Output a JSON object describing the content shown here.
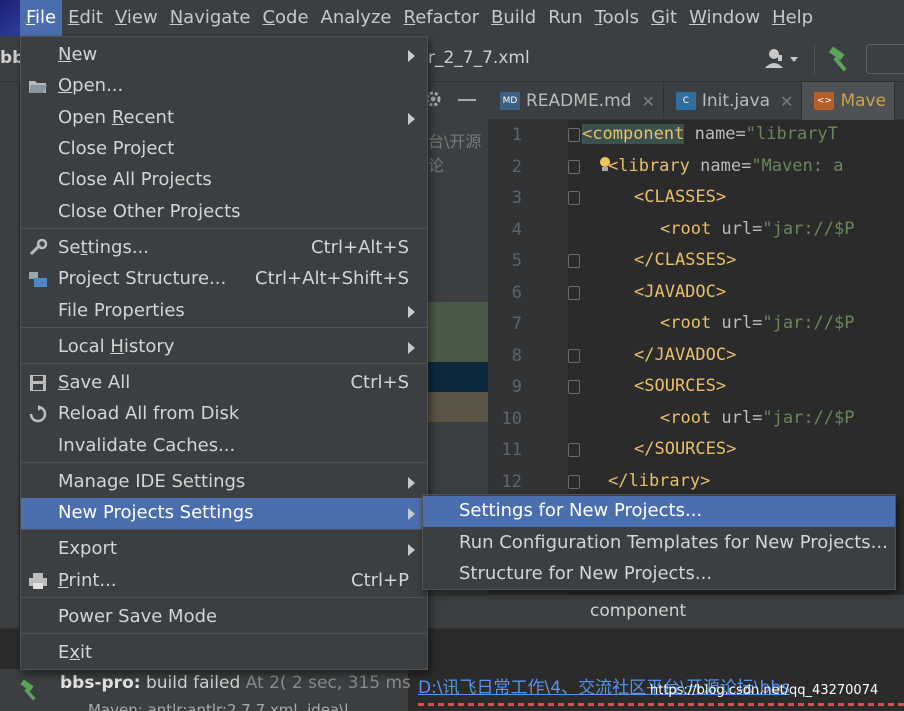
{
  "menubar": {
    "items": [
      {
        "label": "File",
        "mnemonic": "F",
        "rest": "ile"
      },
      {
        "label": "Edit",
        "mnemonic": "E",
        "rest": "dit"
      },
      {
        "label": "View",
        "mnemonic": "V",
        "rest": "iew"
      },
      {
        "label": "Navigate",
        "mnemonic": "N",
        "rest": "avigate"
      },
      {
        "label": "Code",
        "mnemonic": "C",
        "rest": "ode"
      },
      {
        "label": "Analyze",
        "mnemonic": "",
        "rest": "Analyze"
      },
      {
        "label": "Refactor",
        "mnemonic": "R",
        "rest": "efactor"
      },
      {
        "label": "Build",
        "mnemonic": "B",
        "rest": "uild"
      },
      {
        "label": "Run",
        "mnemonic": "",
        "rest": "Run"
      },
      {
        "label": "Tools",
        "mnemonic": "T",
        "rest": "ools"
      },
      {
        "label": "Git",
        "mnemonic": "G",
        "rest": "it"
      },
      {
        "label": "Window",
        "mnemonic": "W",
        "rest": "indow"
      },
      {
        "label": "Help",
        "mnemonic": "H",
        "rest": "elp"
      }
    ]
  },
  "toolbar": {
    "project_fragment": "bb",
    "file_fragment": "r_2_7_7.xml"
  },
  "project_panel": {
    "path_hint": "台\\开源论"
  },
  "tabs": [
    {
      "label": "README.md",
      "icon": "MD",
      "icon_color": "#3d6185"
    },
    {
      "label": "Init.java",
      "icon": "C",
      "icon_color": "#2f6e9e"
    },
    {
      "label": "Mave",
      "icon": "<>",
      "icon_color": "#b5602a"
    }
  ],
  "editor": {
    "lines": [
      {
        "n": "1",
        "tag": "<component",
        "attr": " name=",
        "str": "\"libraryT"
      },
      {
        "n": "2",
        "tag": "<library",
        "attr": " name=",
        "str": "\"Maven: a"
      },
      {
        "n": "3",
        "tag": "<CLASSES>",
        "attr": "",
        "str": ""
      },
      {
        "n": "4",
        "tag": "<root",
        "attr": " url=",
        "str": "\"jar://$P"
      },
      {
        "n": "5",
        "tag": "</CLASSES>",
        "attr": "",
        "str": ""
      },
      {
        "n": "6",
        "tag": "<JAVADOC>",
        "attr": "",
        "str": ""
      },
      {
        "n": "7",
        "tag": "<root",
        "attr": " url=",
        "str": "\"jar://$P"
      },
      {
        "n": "8",
        "tag": "</JAVADOC>",
        "attr": "",
        "str": ""
      },
      {
        "n": "9",
        "tag": "<SOURCES>",
        "attr": "",
        "str": ""
      },
      {
        "n": "10",
        "tag": "<root",
        "attr": " url=",
        "str": "\"jar://$P"
      },
      {
        "n": "11",
        "tag": "</SOURCES>",
        "attr": "",
        "str": ""
      },
      {
        "n": "12",
        "tag": "</library>",
        "attr": "",
        "str": ""
      }
    ],
    "breadcrumb": "component"
  },
  "file_menu": {
    "items": [
      {
        "label": "New",
        "shortcut": "",
        "submenu": true
      },
      {
        "label": "Open...",
        "shortcut": "",
        "submenu": false
      },
      {
        "label": "Open Recent",
        "shortcut": "",
        "submenu": true
      },
      {
        "label": "Close Project",
        "shortcut": "",
        "submenu": false
      },
      {
        "label": "Close All Projects",
        "shortcut": "",
        "submenu": false
      },
      {
        "label": "Close Other Projects",
        "shortcut": "",
        "submenu": false
      },
      {
        "label": "Settings...",
        "shortcut": "Ctrl+Alt+S",
        "submenu": false
      },
      {
        "label": "Project Structure...",
        "shortcut": "Ctrl+Alt+Shift+S",
        "submenu": false
      },
      {
        "label": "File Properties",
        "shortcut": "",
        "submenu": true
      },
      {
        "label": "Local History",
        "shortcut": "",
        "submenu": true
      },
      {
        "label": "Save All",
        "shortcut": "Ctrl+S",
        "submenu": false
      },
      {
        "label": "Reload All from Disk",
        "shortcut": "",
        "submenu": false
      },
      {
        "label": "Invalidate Caches...",
        "shortcut": "",
        "submenu": false
      },
      {
        "label": "Manage IDE Settings",
        "shortcut": "",
        "submenu": true
      },
      {
        "label": "New Projects Settings",
        "shortcut": "",
        "submenu": true
      },
      {
        "label": "Export",
        "shortcut": "",
        "submenu": true
      },
      {
        "label": "Print...",
        "shortcut": "Ctrl+P",
        "submenu": false
      },
      {
        "label": "Power Save Mode",
        "shortcut": "",
        "submenu": false
      },
      {
        "label": "Exit",
        "shortcut": "",
        "submenu": false
      }
    ]
  },
  "new_projects_submenu": {
    "items": [
      {
        "label": "Settings for New Projects..."
      },
      {
        "label": "Run Configuration Templates for New Projects..."
      },
      {
        "label": "Structure for New Projects..."
      }
    ]
  },
  "bottom": {
    "build_project": "bbs-pro:",
    "build_status": " build failed",
    "build_time": " At 2(",
    "build_duration": " 2 sec, 315 ms",
    "console_path": "D:\\讯飞日常工作\\4、交流社区平台\\开源论坛\\bbs",
    "watermark": "https://blog.csdn.net/qq_43270074",
    "row2": "Maven: antlr:antlr:2.7.7.xml .idea\\l"
  },
  "colors": {
    "accent": "#4b6eaf",
    "menu_bg": "#3c3f41",
    "editor_bg": "#2b2b2b",
    "xml_tag": "#e8bf6a",
    "xml_string": "#6a8759",
    "link": "#5394ec"
  }
}
